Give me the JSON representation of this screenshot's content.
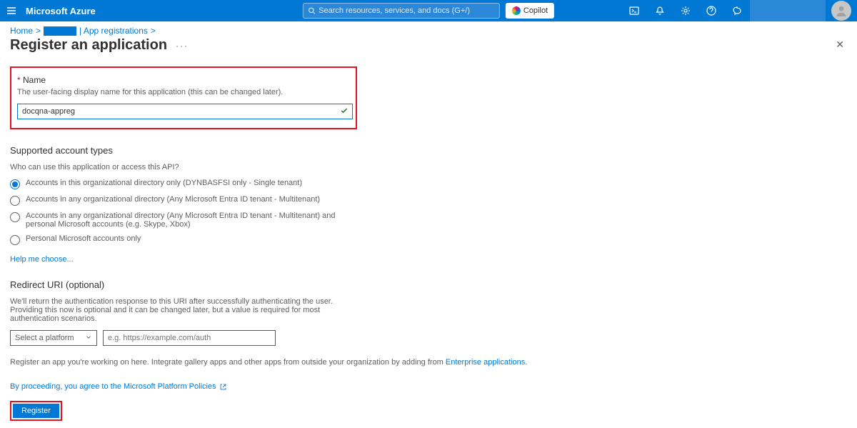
{
  "header": {
    "brand": "Microsoft Azure",
    "search_placeholder": "Search resources, services, and docs (G+/)",
    "copilot": "Copilot"
  },
  "breadcrumb": {
    "home": "Home",
    "app_reg": "| App registrations"
  },
  "page": {
    "title": "Register an application"
  },
  "name_section": {
    "label": "Name",
    "helper": "The user-facing display name for this application (this can be changed later).",
    "value": "docqna-appreg"
  },
  "account_types": {
    "heading": "Supported account types",
    "subtext": "Who can use this application or access this API?",
    "options": [
      "Accounts in this organizational directory only (DYNBASFSI only - Single tenant)",
      "Accounts in any organizational directory (Any Microsoft Entra ID tenant - Multitenant)",
      "Accounts in any organizational directory (Any Microsoft Entra ID tenant - Multitenant) and personal Microsoft accounts (e.g. Skype, Xbox)",
      "Personal Microsoft accounts only"
    ],
    "help_link": "Help me choose..."
  },
  "redirect": {
    "heading": "Redirect URI (optional)",
    "subtext": "We'll return the authentication response to this URI after successfully authenticating the user. Providing this now is optional and it can be changed later, but a value is required for most authentication scenarios.",
    "platform_placeholder": "Select a platform",
    "uri_placeholder": "e.g. https://example.com/auth"
  },
  "bottom": {
    "note_prefix": "Register an app you're working on here. Integrate gallery apps and other apps from outside your organization by adding from ",
    "note_link": "Enterprise applications",
    "policy_text": "By proceeding, you agree to the Microsoft Platform Policies",
    "register": "Register"
  }
}
